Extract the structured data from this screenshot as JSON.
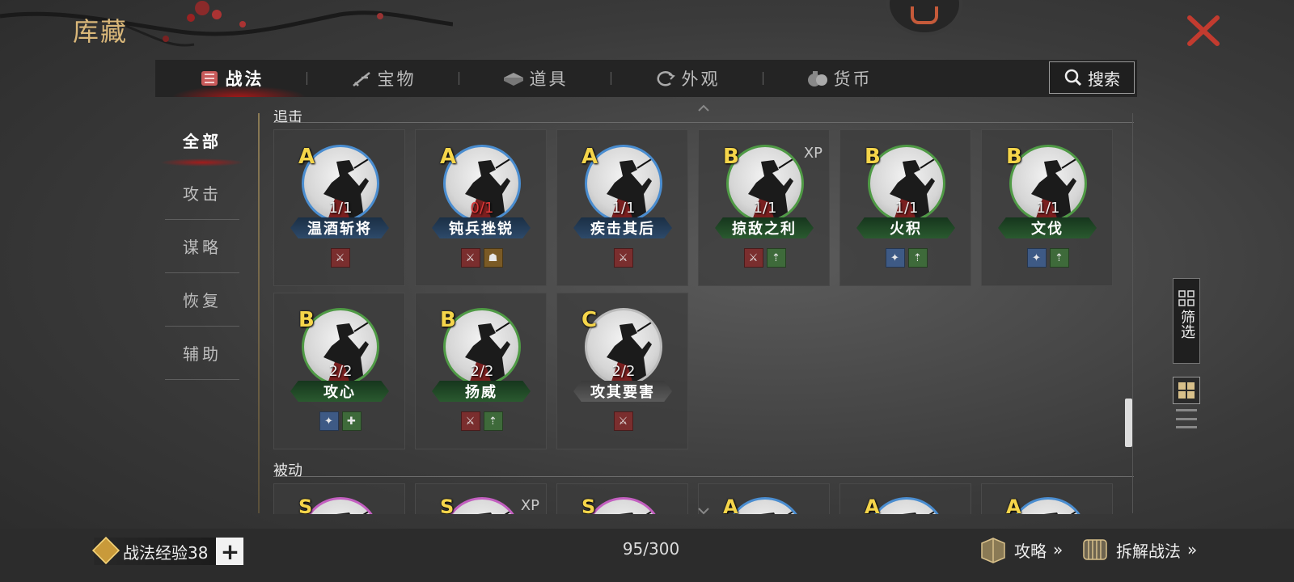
{
  "header": {
    "title": "库藏",
    "close_icon": "close-icon"
  },
  "tabs": [
    {
      "label": "战法",
      "icon": "tactic-icon",
      "active": true
    },
    {
      "label": "宝物",
      "icon": "treasure-icon",
      "active": false
    },
    {
      "label": "道具",
      "icon": "item-icon",
      "active": false
    },
    {
      "label": "外观",
      "icon": "appearance-icon",
      "active": false
    },
    {
      "label": "货币",
      "icon": "currency-icon",
      "active": false
    }
  ],
  "search": {
    "label": "搜索",
    "icon": "search-icon"
  },
  "sidebar": {
    "items": [
      {
        "label": "全部",
        "active": true
      },
      {
        "label": "攻击",
        "active": false
      },
      {
        "label": "谋略",
        "active": false
      },
      {
        "label": "恢复",
        "active": false
      },
      {
        "label": "辅助",
        "active": false
      }
    ]
  },
  "sections": [
    {
      "title": "追击",
      "cards": [
        {
          "grade": "A",
          "count": "1/1",
          "name": "温酒斩将",
          "xp": "",
          "ring": "blue",
          "tags": [
            "attack"
          ]
        },
        {
          "grade": "A",
          "count": "0/1",
          "name": "钝兵挫锐",
          "xp": "",
          "ring": "blue",
          "tags": [
            "attack",
            "control"
          ]
        },
        {
          "grade": "A",
          "count": "1/1",
          "name": "疾击其后",
          "xp": "",
          "ring": "blue",
          "tags": [
            "attack"
          ]
        },
        {
          "grade": "B",
          "count": "1/1",
          "name": "掠敌之利",
          "xp": "XP",
          "ring": "green",
          "tags": [
            "attack",
            "buff"
          ]
        },
        {
          "grade": "B",
          "count": "1/1",
          "name": "火积",
          "xp": "",
          "ring": "green",
          "tags": [
            "strategy",
            "buff"
          ]
        },
        {
          "grade": "B",
          "count": "1/1",
          "name": "文伐",
          "xp": "",
          "ring": "green",
          "tags": [
            "strategy",
            "buff"
          ]
        },
        {
          "grade": "B",
          "count": "2/2",
          "name": "攻心",
          "xp": "",
          "ring": "green",
          "tags": [
            "strategy",
            "heal"
          ]
        },
        {
          "grade": "B",
          "count": "2/2",
          "name": "扬威",
          "xp": "",
          "ring": "green",
          "tags": [
            "attack",
            "buff"
          ]
        },
        {
          "grade": "C",
          "count": "2/2",
          "name": "攻其要害",
          "xp": "",
          "ring": "gray",
          "tags": [
            "attack"
          ]
        }
      ]
    },
    {
      "title": "被动",
      "cards": [
        {
          "grade": "S",
          "xp": "",
          "ring": "purple"
        },
        {
          "grade": "S",
          "xp": "XP",
          "ring": "purple"
        },
        {
          "grade": "S",
          "xp": "",
          "ring": "purple"
        },
        {
          "grade": "A",
          "xp": "",
          "ring": "blue"
        },
        {
          "grade": "A",
          "xp": "",
          "ring": "blue"
        },
        {
          "grade": "A",
          "xp": "",
          "ring": "blue"
        }
      ]
    }
  ],
  "right_controls": {
    "filter_label": "筛选",
    "filter_icon": "filter-grid-icon",
    "grid_view_icon": "grid-view-icon",
    "list_view_icon": "list-view-icon"
  },
  "footer": {
    "exp_label": "战法经验38",
    "plus": "+",
    "counter": "95/300",
    "guide_label": "攻略",
    "dismantle_label": "拆解战法",
    "arrows": "»"
  },
  "colors": {
    "grade_text": "#f5d54a",
    "zero_count": "#e03a3a",
    "active_tab_glow": "#c81414",
    "ring_blue": "#4a8dd0",
    "ring_green": "#4f9a45",
    "ring_gray": "#bbbbbb",
    "ring_purple": "#c35fc0"
  }
}
